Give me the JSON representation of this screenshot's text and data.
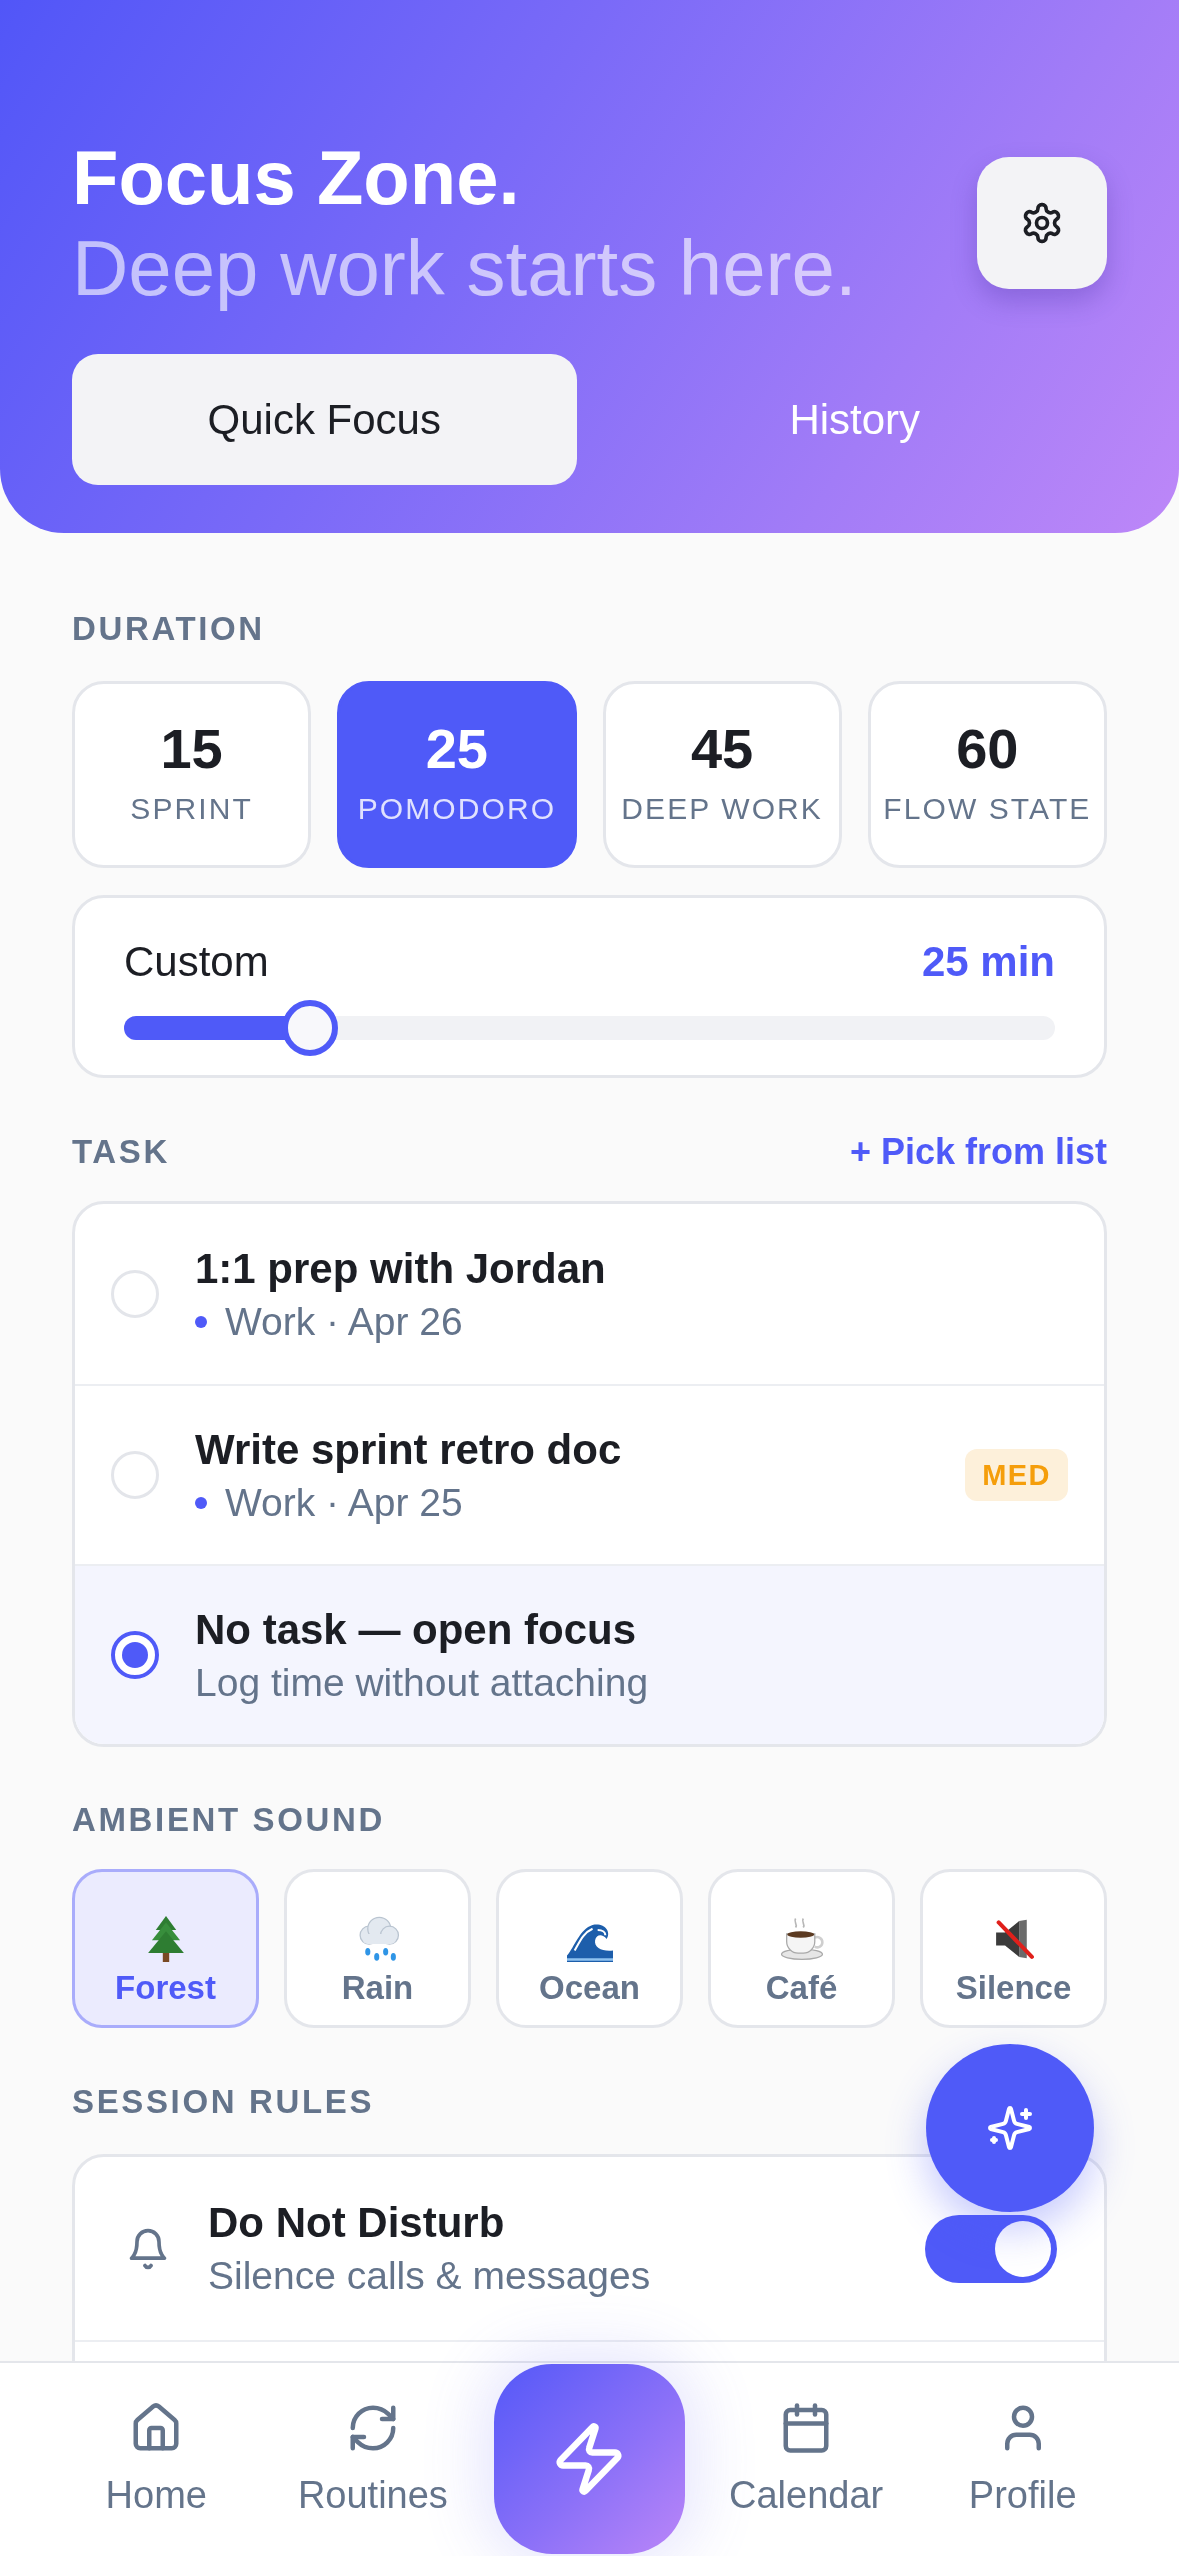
{
  "header": {
    "title": "Focus Zone.",
    "subtitle": "Deep work starts here.",
    "tabs": [
      {
        "label": "Quick Focus",
        "selected": true
      },
      {
        "label": "History",
        "selected": false
      }
    ]
  },
  "duration": {
    "label": "DURATION",
    "presets": [
      {
        "minutes": "15",
        "name": "SPRINT",
        "selected": false
      },
      {
        "minutes": "25",
        "name": "POMODORO",
        "selected": true
      },
      {
        "minutes": "45",
        "name": "DEEP WORK",
        "selected": false
      },
      {
        "minutes": "60",
        "name": "FLOW STATE",
        "selected": false
      }
    ],
    "custom": {
      "label": "Custom",
      "reading": "25 min",
      "level": 0.2
    }
  },
  "task": {
    "label": "TASK",
    "action": "+ Pick from list",
    "items": [
      {
        "kind": "task",
        "title": "1:1 prep with Jordan",
        "meta": "Work · Apr 26",
        "selected": false
      },
      {
        "kind": "task",
        "title": "Write sprint retro doc",
        "meta": "Work · Apr 25",
        "badge": "MED",
        "selected": false
      },
      {
        "kind": "none",
        "title": "No task — open focus",
        "meta": "Log time without attaching",
        "selected": true
      }
    ]
  },
  "ambient_sound": {
    "label": "AMBIENT SOUND",
    "options": [
      {
        "label": "Forest",
        "selected": true
      },
      {
        "label": "Rain",
        "selected": false
      },
      {
        "label": "Ocean",
        "selected": false
      },
      {
        "label": "Café",
        "selected": false
      },
      {
        "label": "Silence",
        "selected": false
      }
    ]
  },
  "session_rules": {
    "label": "SESSION RULES",
    "items": [
      {
        "title": "Do Not Disturb",
        "subtitle": "Silence calls & messages",
        "on": true
      }
    ]
  },
  "bottom_nav": {
    "items": [
      {
        "kind": "tab",
        "label": "Home",
        "selected": false
      },
      {
        "kind": "tab",
        "label": "Routines",
        "selected": false
      },
      {
        "kind": "action"
      },
      {
        "kind": "tab",
        "label": "Calendar",
        "selected": false
      },
      {
        "kind": "tab",
        "label": "Profile",
        "selected": false
      }
    ]
  }
}
